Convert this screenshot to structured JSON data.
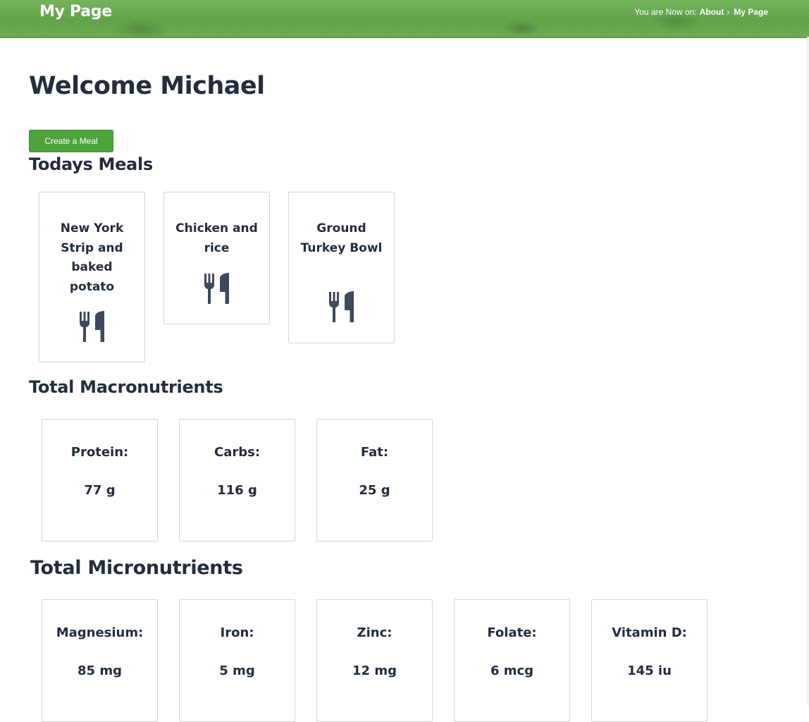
{
  "header": {
    "site_title": "My Page",
    "breadcrumb_prefix": "You are Now on:",
    "breadcrumb": [
      {
        "label": "About"
      },
      {
        "label": "My Page"
      }
    ],
    "separator": "›"
  },
  "welcome": "Welcome Michael",
  "create_meal_label": "Create a Meal",
  "todays_meals": {
    "title": "Todays Meals",
    "items": [
      {
        "name": "New York Strip and baked potato",
        "icon": "utensils-icon"
      },
      {
        "name": "Chicken and rice",
        "icon": "utensils-icon"
      },
      {
        "name": "Ground Turkey Bowl",
        "icon": "utensils-icon"
      }
    ]
  },
  "macronutrients": {
    "title": "Total Macronutrients",
    "items": [
      {
        "label": "Protein:",
        "value": "77 g"
      },
      {
        "label": "Carbs:",
        "value": "116 g"
      },
      {
        "label": "Fat:",
        "value": "25 g"
      }
    ]
  },
  "micronutrients": {
    "title": "Total Micronutrients",
    "items": [
      {
        "label": "Magnesium:",
        "value": "85 mg"
      },
      {
        "label": "Iron:",
        "value": "5 mg"
      },
      {
        "label": "Zinc:",
        "value": "12 mg"
      },
      {
        "label": "Folate:",
        "value": "6 mcg"
      },
      {
        "label": "Vitamin D:",
        "value": "145 iu"
      }
    ]
  },
  "colors": {
    "header_green": "#5fa445",
    "button_green": "#4da33a",
    "heading_text": "#232d3e",
    "icon_slate": "#3d4a5c"
  }
}
